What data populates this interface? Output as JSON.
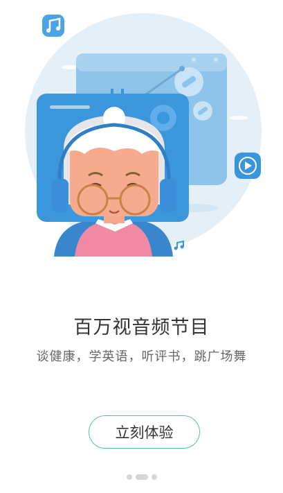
{
  "onboarding": {
    "title": "百万视音频节目",
    "subtitle": "谈健康，学英语，听评书，跳广场舞",
    "cta_label": "立刻体验",
    "page_index": 2,
    "page_count": 3
  },
  "colors": {
    "accent": "#52c2a7",
    "hero_circle": "#e3eef7",
    "device_blue": "#2f8fd8",
    "device_light": "#79b7e6"
  },
  "icons": [
    "music-note-icon",
    "play-icon",
    "small-music-note-icon"
  ]
}
